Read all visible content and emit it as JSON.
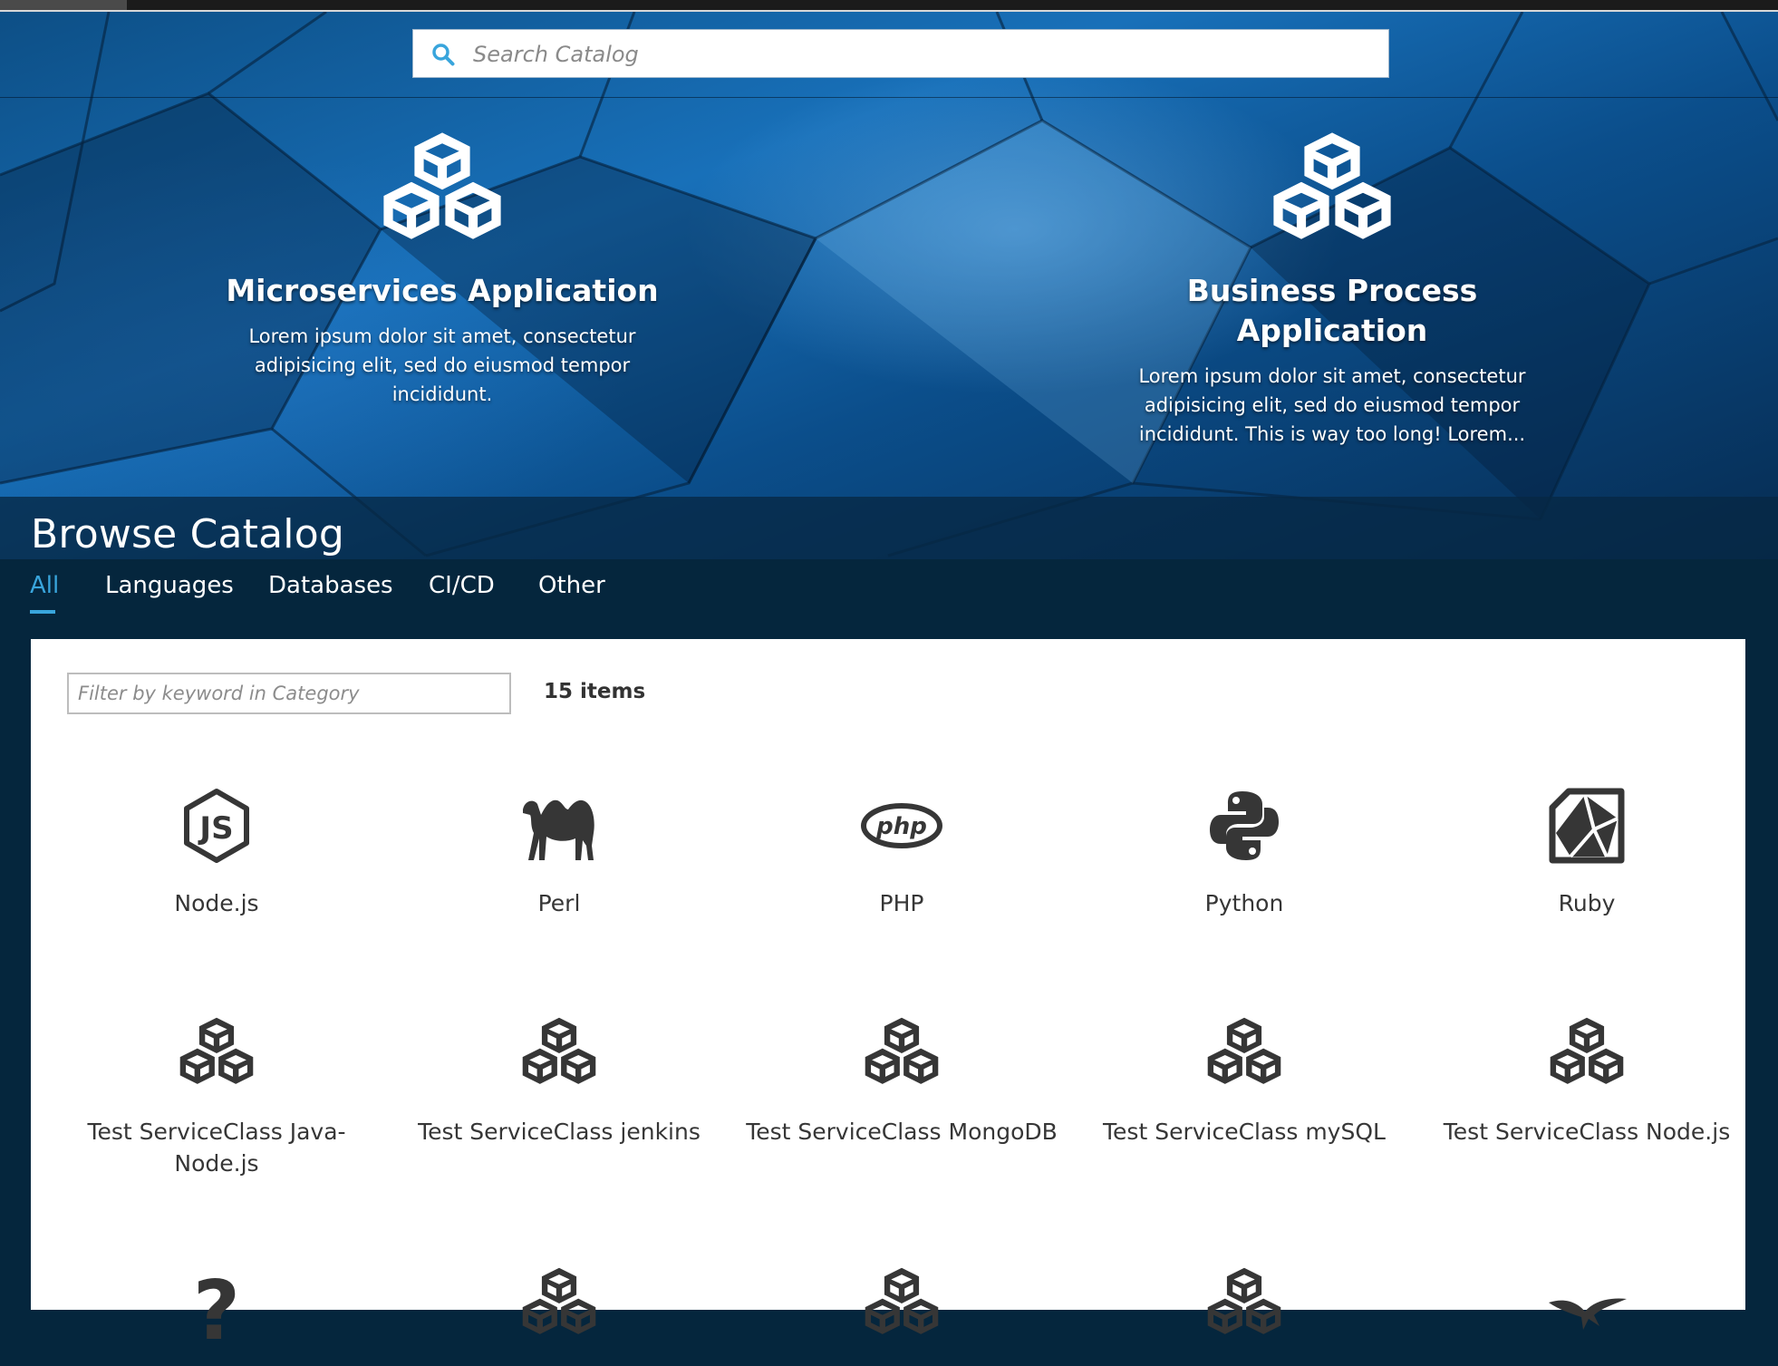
{
  "search": {
    "placeholder": "Search Catalog"
  },
  "featured": [
    {
      "icon": "cubes-icon",
      "title": "Microservices Application",
      "description": "Lorem ipsum dolor sit amet, consectetur adipisicing elit, sed do eiusmod tempor incididunt."
    },
    {
      "icon": "cubes-icon",
      "title": "Business Process Application",
      "description": "Lorem ipsum dolor sit amet, consectetur adipisicing elit, sed do eiusmod tempor incididunt. This is way too long! Lorem..."
    }
  ],
  "browse": {
    "title": "Browse Catalog"
  },
  "tabs": [
    {
      "label": "All",
      "active": true
    },
    {
      "label": "Languages"
    },
    {
      "label": "Databases"
    },
    {
      "label": "CI/CD"
    },
    {
      "label": "Other"
    }
  ],
  "filter": {
    "placeholder": "Filter by keyword in Category",
    "count_label": "15 items"
  },
  "catalog_items": [
    {
      "label": "Node.js",
      "icon": "nodejs-icon"
    },
    {
      "label": "Perl",
      "icon": "perl-camel-icon"
    },
    {
      "label": "PHP",
      "icon": "php-icon"
    },
    {
      "label": "Python",
      "icon": "python-icon"
    },
    {
      "label": "Ruby",
      "icon": "ruby-icon"
    },
    {
      "label": "Test ServiceClass Java-Node.js",
      "icon": "cubes-icon"
    },
    {
      "label": "Test ServiceClass jenkins",
      "icon": "cubes-icon"
    },
    {
      "label": "Test ServiceClass MongoDB",
      "icon": "cubes-icon"
    },
    {
      "label": "Test ServiceClass mySQL",
      "icon": "cubes-icon"
    },
    {
      "label": "Test ServiceClass Node.js",
      "icon": "cubes-icon"
    },
    {
      "label": "",
      "icon": "question-mark-icon"
    },
    {
      "label": "",
      "icon": "cubes-icon"
    },
    {
      "label": "",
      "icon": "cubes-icon"
    },
    {
      "label": "",
      "icon": "cubes-icon"
    },
    {
      "label": "",
      "icon": "bird-icon"
    }
  ],
  "colors": {
    "accent": "#39a5dc",
    "dark_background": "#05263d",
    "icon_gray": "#363636"
  }
}
